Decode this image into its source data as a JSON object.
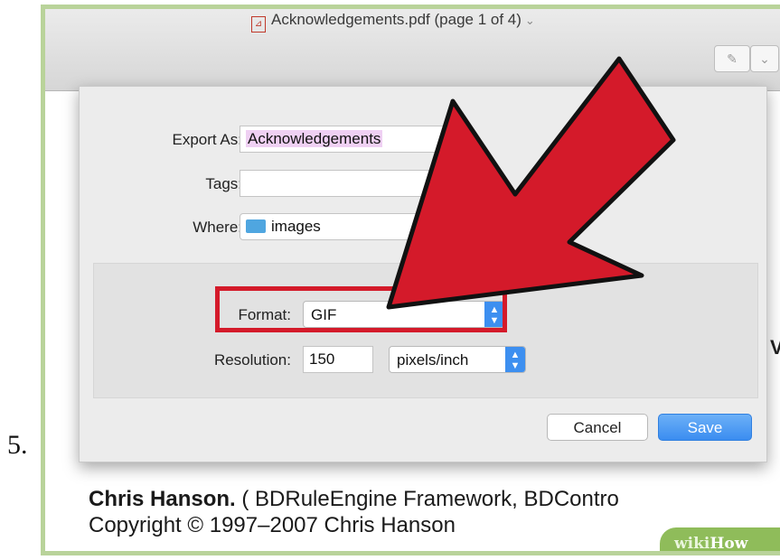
{
  "step_number": "5.",
  "window": {
    "title": "Acknowledgements.pdf (page 1 of 4)",
    "pdf_icon": "pdf-icon",
    "toolbar_icons": [
      "pen-icon",
      "chevron-down-icon"
    ]
  },
  "dialog": {
    "export_as": {
      "label": "Export As:",
      "value": "Acknowledgements"
    },
    "tags": {
      "label": "Tags:",
      "value": ""
    },
    "where": {
      "label": "Where:",
      "value": "images",
      "icon": "folder-icon"
    },
    "format": {
      "label": "Format:",
      "value": "GIF"
    },
    "resolution": {
      "label": "Resolution:",
      "value": "150",
      "unit": "pixels/inch"
    },
    "cancel_label": "Cancel",
    "save_label": "Save"
  },
  "document": {
    "line1_bold": "Chris Hanson.",
    "line1_rest": " ( BDRuleEngine Framework, BDContro",
    "line2": "Copyright © 1997–2007 Chris Hanson",
    "side_letter": "V"
  },
  "overlay": {
    "arrow_color": "#d41a2a",
    "highlight_color": "#d41a2a"
  },
  "watermark": {
    "prefix": "wiki",
    "suffix": "How"
  }
}
